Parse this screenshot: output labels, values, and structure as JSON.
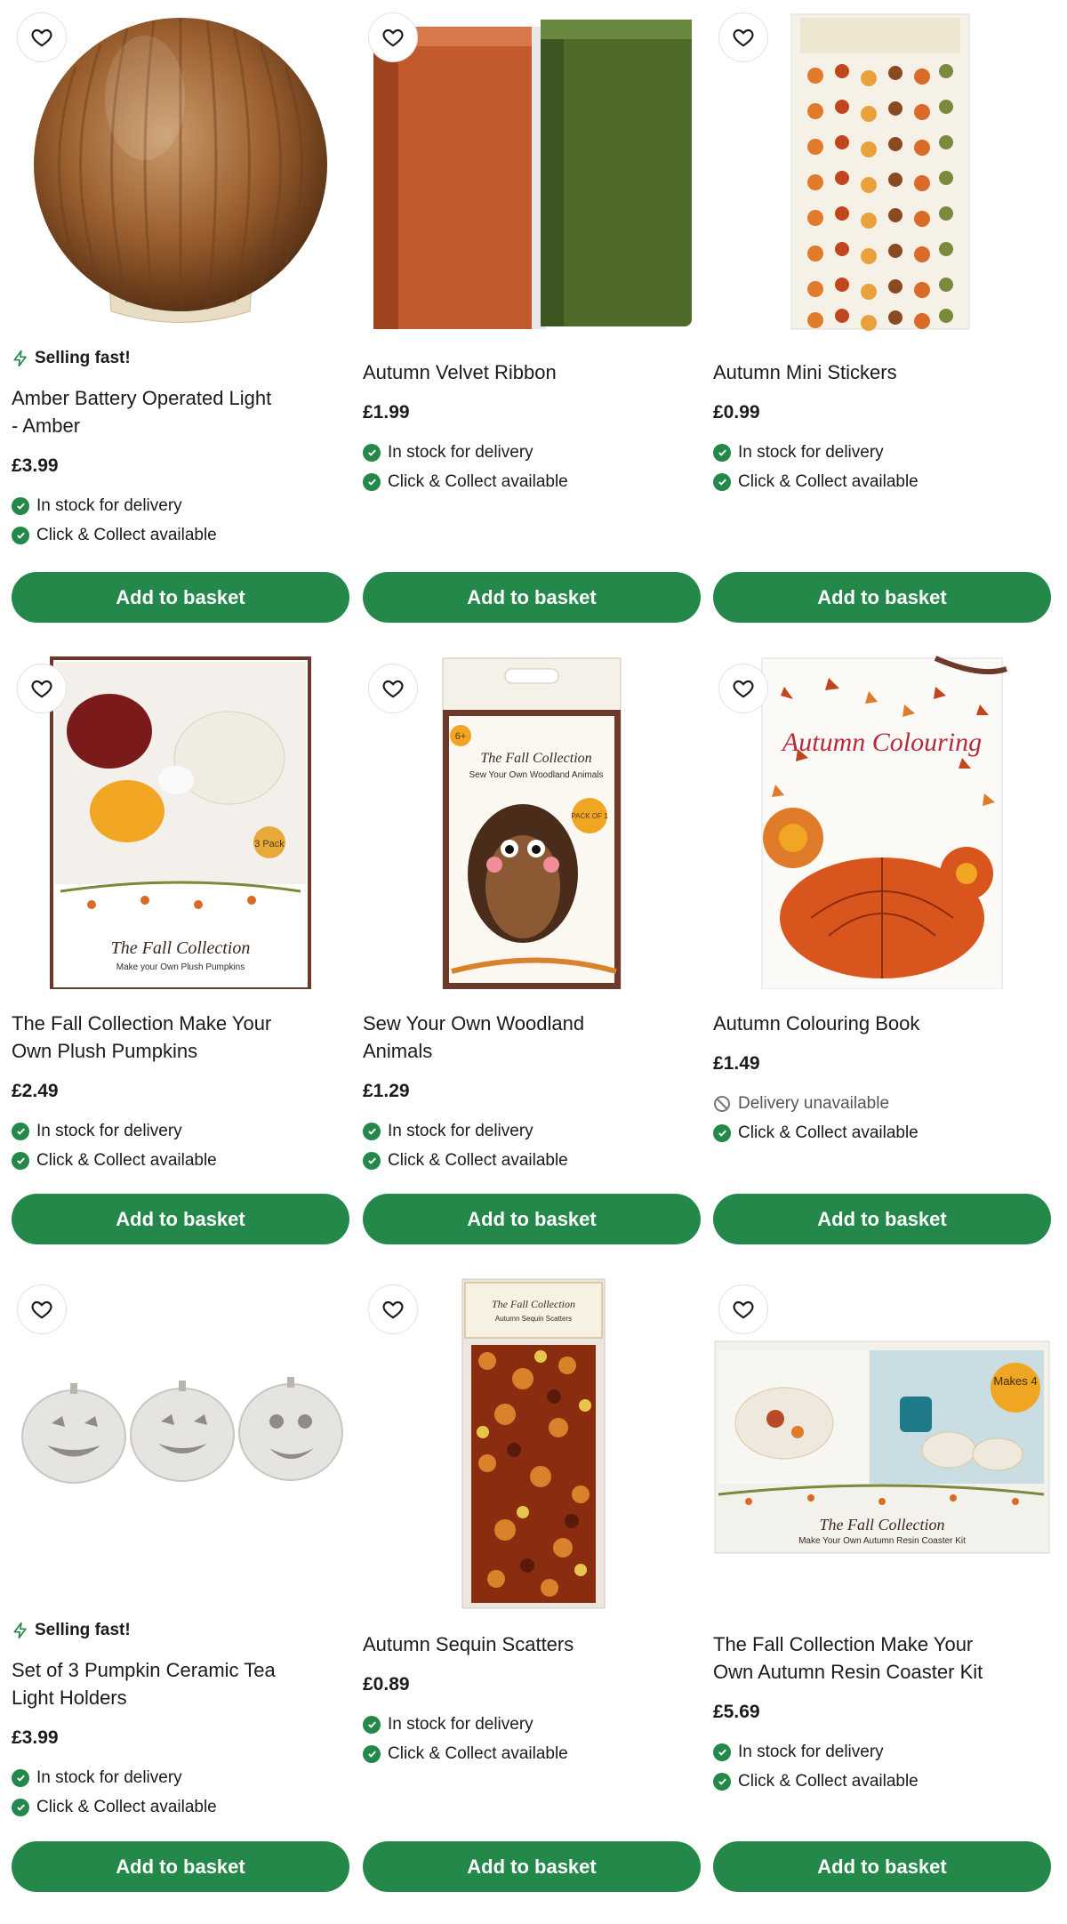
{
  "colors": {
    "accent": "#23884a",
    "text": "#1b1b1b"
  },
  "products": [
    {
      "badge": "Selling fast!",
      "title_lines": [
        "Amber Battery Operated Light",
        "- Amber"
      ],
      "price": "£3.99",
      "delivery": "In stock for delivery",
      "collect": "Click & Collect available",
      "button": "Add to basket",
      "delivery_available": true,
      "image": "amber-globe-lamp"
    },
    {
      "badge": "",
      "title_lines": [
        "Autumn Velvet Ribbon"
      ],
      "price": "£1.99",
      "delivery": "In stock for delivery",
      "collect": "Click & Collect available",
      "button": "Add to basket",
      "delivery_available": true,
      "image": "velvet-ribbon-rolls"
    },
    {
      "badge": "",
      "title_lines": [
        "Autumn Mini Stickers"
      ],
      "price": "£0.99",
      "delivery": "In stock for delivery",
      "collect": "Click & Collect available",
      "button": "Add to basket",
      "delivery_available": true,
      "image": "sticker-sheet"
    },
    {
      "badge": "",
      "title_lines": [
        "The Fall Collection Make Your",
        "Own Plush Pumpkins"
      ],
      "price": "£2.49",
      "delivery": "In stock for delivery",
      "collect": "Click & Collect available",
      "button": "Add to basket",
      "delivery_available": true,
      "image": "plush-pumpkins-box",
      "box_text": "The Fall Collection",
      "box_sub": "Make your Own Plush Pumpkins",
      "pack": "3 Pack"
    },
    {
      "badge": "",
      "title_lines": [
        "Sew Your Own Woodland",
        "Animals"
      ],
      "price": "£1.29",
      "delivery": "In stock for delivery",
      "collect": "Click & Collect available",
      "button": "Add to basket",
      "delivery_available": true,
      "image": "woodland-animals-kit",
      "box_text": "The Fall Collection",
      "box_sub": "Sew Your Own Woodland Animals",
      "age": "6+",
      "pack": "PACK OF 1"
    },
    {
      "badge": "",
      "title_lines": [
        "Autumn Colouring Book"
      ],
      "price": "£1.49",
      "delivery": "Delivery unavailable",
      "collect": "Click & Collect available",
      "button": "Add to basket",
      "delivery_available": false,
      "image": "colouring-book",
      "box_text": "Autumn Colouring"
    },
    {
      "badge": "Selling fast!",
      "title_lines": [
        "Set of 3 Pumpkin Ceramic Tea",
        "Light Holders"
      ],
      "price": "£3.99",
      "delivery": "In stock for delivery",
      "collect": "Click & Collect available",
      "button": "Add to basket",
      "delivery_available": true,
      "image": "ceramic-pumpkins"
    },
    {
      "badge": "",
      "title_lines": [
        "Autumn Sequin Scatters"
      ],
      "price": "£0.89",
      "delivery": "In stock for delivery",
      "collect": "Click & Collect available",
      "button": "Add to basket",
      "delivery_available": true,
      "image": "sequin-scatters",
      "box_text": "The Fall Collection",
      "box_sub": "Autumn Sequin Scatters"
    },
    {
      "badge": "",
      "title_lines": [
        "The Fall Collection Make Your",
        "Own Autumn Resin Coaster Kit"
      ],
      "price": "£5.69",
      "delivery": "In stock for delivery",
      "collect": "Click & Collect available",
      "button": "Add to basket",
      "delivery_available": true,
      "image": "resin-coaster-kit",
      "box_text": "The Fall Collection",
      "box_sub": "Make Your Own Autumn Resin Coaster Kit",
      "makes": "Makes 4"
    }
  ]
}
